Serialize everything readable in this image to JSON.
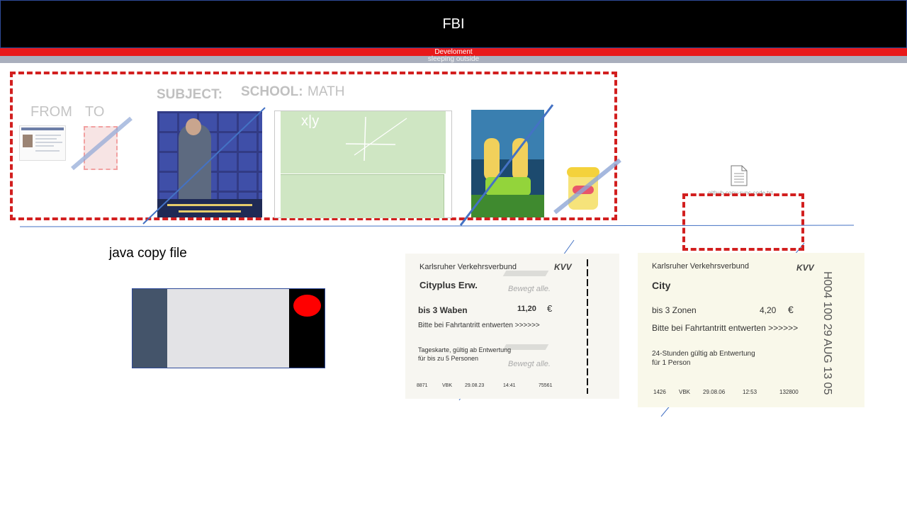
{
  "header": {
    "title": "FBI",
    "red_bar_text": "Develoment",
    "gray_bar_text": "sleeping outside"
  },
  "top_panel": {
    "from_label": "FROM",
    "to_label": "TO",
    "subject_label": "SUBJECT:",
    "school_label": "SCHOOL:",
    "school_value": "MATH",
    "graph_label": "x|y"
  },
  "document": {
    "icon": "document-icon",
    "caption": "github-copy-sync-code.txt"
  },
  "java_label": "java copy file",
  "tickets": [
    {
      "company": "Karlsruher Verkehrsverbund",
      "logo": "KVV",
      "name": "Cityplus Erw.",
      "slogan": "Bewegt alle.",
      "zones": "bis 3 Waben",
      "price": "11,20",
      "currency": "€",
      "validate": "Bitte bei Fahrtantritt entwerten >>>>>>",
      "validity_1": "Tageskarte, gültig ab Entwertung",
      "validity_2": "für bis zu 5 Personen",
      "slogan_2": "Bewegt alle.",
      "footer": [
        "8871",
        "VBK",
        "29.08.23",
        "14:41",
        "75561"
      ]
    },
    {
      "company": "Karlsruher Verkehrsverbund",
      "logo": "KVV",
      "name": "City",
      "zones": "bis 3 Zonen",
      "price": "4,20",
      "currency": "€",
      "validate": "Bitte bei Fahrtantritt entwerten >>>>>>",
      "validity_1": "24-Stunden gültig ab Entwertung",
      "validity_2": "für 1 Person",
      "stamp": "H004 100 29 AUG 13 05",
      "footer": [
        "1426",
        "VBK",
        "29.08.06",
        "12:53",
        "132800"
      ]
    }
  ],
  "colors": {
    "header_bg": "#000000",
    "red_bar": "#e8191a",
    "gray_bar": "#a9afbd",
    "dashed_border": "#d21f1f",
    "strike_line": "#4472c4",
    "widget_left": "#44546a",
    "widget_dot": "#ff0000"
  }
}
